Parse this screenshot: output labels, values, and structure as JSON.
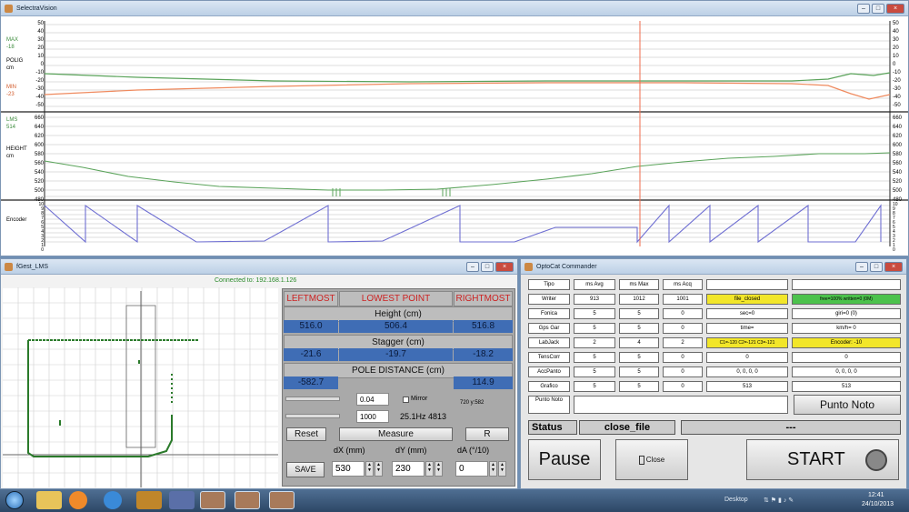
{
  "top_window": {
    "title": "SelectraVision",
    "plot1": {
      "labels": [
        "MAX",
        "-18",
        "POLIG",
        "cm",
        "MIN",
        "-23"
      ],
      "ticks_left": [
        "50",
        "40",
        "30",
        "20",
        "10",
        "0",
        "-10",
        "-20",
        "-30",
        "-40",
        "-50"
      ],
      "ticks_right": [
        "50",
        "40",
        "30",
        "20",
        "10",
        "0",
        "-10",
        "-20",
        "-30",
        "-40",
        "-50"
      ]
    },
    "plot2": {
      "labels": [
        "LMS",
        "514",
        "HEIGHT",
        "cm"
      ],
      "ticks_left": [
        "660",
        "640",
        "620",
        "600",
        "580",
        "560",
        "540",
        "520",
        "500",
        "480"
      ],
      "ticks_right": [
        "660",
        "640",
        "620",
        "600",
        "580",
        "560",
        "540",
        "520",
        "500",
        "480"
      ]
    },
    "plot3": {
      "label": "Encoder",
      "ticks_left": [
        "10",
        "9",
        "8",
        "7",
        "6",
        "5",
        "4",
        "3",
        "2",
        "1",
        "0"
      ],
      "ticks_right": [
        "10",
        "9",
        "8",
        "7",
        "6",
        "5",
        "4",
        "3",
        "2",
        "1",
        "0"
      ]
    },
    "colors": {
      "max_line": "#5aa35a",
      "min_line": "#ef8a5e",
      "cursor": "#ef6b4c",
      "encoder": "#6e6ed2"
    }
  },
  "lms_window": {
    "title": "fGest_LMS",
    "connected": "Connected to: 192.168.1.126",
    "headers": {
      "leftmost": "LEFTMOST",
      "lowest": "LOWEST POINT",
      "rightmost": "RIGHTMOST"
    },
    "height": {
      "title": "Height (cm)",
      "left": "516.0",
      "mid": "506.4",
      "right": "516.8"
    },
    "stagger": {
      "title": "Stagger (cm)",
      "left": "-21.6",
      "mid": "-19.7",
      "right": "-18.2"
    },
    "pole": {
      "title": "POLE DISTANCE (cm)",
      "left": "-582.7",
      "right": "114.9"
    },
    "field1": "0.04",
    "field2": "1000",
    "mirror": "Mirror",
    "xy": "720 y:582",
    "freq": "25.1Hz 4813",
    "reset": "Reset",
    "measure": "Measure",
    "r": "R",
    "dx_label": "dX (mm)",
    "dy_label": "dY (mm)",
    "da_label": "dA (°/10)",
    "save": "SAVE",
    "dx": "530",
    "dy": "230",
    "da": "0"
  },
  "opto_window": {
    "title": "OptoCat Commander",
    "col_headers": [
      "Tipo",
      "ms Avg",
      "ms Max",
      "ms Acq"
    ],
    "rows": [
      {
        "name": "Writer",
        "avg": "913",
        "max": "1012",
        "acq": "1001",
        "c5": "file_closed",
        "c6": "free=100% written=0 (0M)"
      },
      {
        "name": "Fonica",
        "avg": "5",
        "max": "5",
        "acq": "0",
        "c5": "sec=0",
        "c6": "giri=0 (0)"
      },
      {
        "name": "Gps Gar",
        "avg": "5",
        "max": "5",
        "acq": "0",
        "c5": "time=",
        "c6": "km/h= 0"
      },
      {
        "name": "LabJack",
        "avg": "2",
        "max": "4",
        "acq": "2",
        "c5": "C1=-120 C2=-121 C3=-121",
        "c6": "Encoder: -10"
      },
      {
        "name": "TensCorr",
        "avg": "5",
        "max": "5",
        "acq": "0",
        "c5": "0",
        "c6": "0"
      },
      {
        "name": "AccPanto",
        "avg": "5",
        "max": "5",
        "acq": "0",
        "c5": "0, 0, 0, 0",
        "c6": "0, 0, 0, 0"
      },
      {
        "name": "Grafico",
        "avg": "5",
        "max": "5",
        "acq": "0",
        "c5": "513",
        "c6": "513"
      }
    ],
    "punto_label": "Punto Noto",
    "punto_button": "Punto Noto",
    "status_label": "Status",
    "status_value": "close_file",
    "status_right": "---",
    "pause": "Pause",
    "close": "Close",
    "start": "START",
    "colors": {
      "yellow": "#f2e629",
      "green": "#4cc24c"
    }
  },
  "taskbar": {
    "desktop": "Desktop",
    "time": "12:41",
    "date": "24/10/2013"
  }
}
